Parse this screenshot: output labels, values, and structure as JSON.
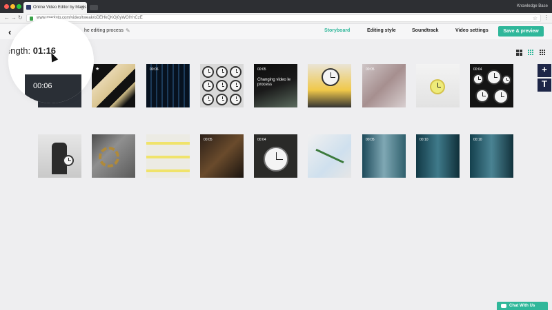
{
  "browser": {
    "tab_title": "Online Video Editor by Magis",
    "url": "www.magisto.com/video/tweak/oDEHkQKOj0yWOlYnCzE",
    "knowledge_base": "Knowledge Base"
  },
  "header": {
    "project_title": "he editing process",
    "tabs": [
      "Storyboard",
      "Editing style",
      "Soundtrack",
      "Video settings"
    ],
    "active_tab": "Storyboard",
    "save_label": "Save & preview"
  },
  "length": {
    "label": "ength:",
    "value": "01:16"
  },
  "zoom_duration": "00:06",
  "tiles_row1": [
    {
      "dur": "",
      "star": true,
      "text": ""
    },
    {
      "dur": "00:06",
      "star": false,
      "text": ""
    },
    {
      "dur": "",
      "star": false,
      "text": ""
    },
    {
      "dur": "00:05",
      "star": false,
      "text": "Changing video le process"
    },
    {
      "dur": "",
      "star": false,
      "text": ""
    },
    {
      "dur": "00:05",
      "star": false,
      "text": ""
    },
    {
      "dur": "",
      "star": false,
      "text": ""
    },
    {
      "dur": "00:04",
      "star": false,
      "text": ""
    }
  ],
  "tiles_row2": [
    {
      "dur": ""
    },
    {
      "dur": ""
    },
    {
      "dur": ""
    },
    {
      "dur": "00:05"
    },
    {
      "dur": "00:04"
    },
    {
      "dur": ""
    },
    {
      "dur": "00:05"
    },
    {
      "dur": "00:10"
    },
    {
      "dur": "00:10"
    }
  ],
  "side_buttons": [
    "+",
    "T"
  ],
  "chat_label": "Chat With Us",
  "colors": {
    "accent": "#2fb79a",
    "side_button": "#1d2547"
  }
}
